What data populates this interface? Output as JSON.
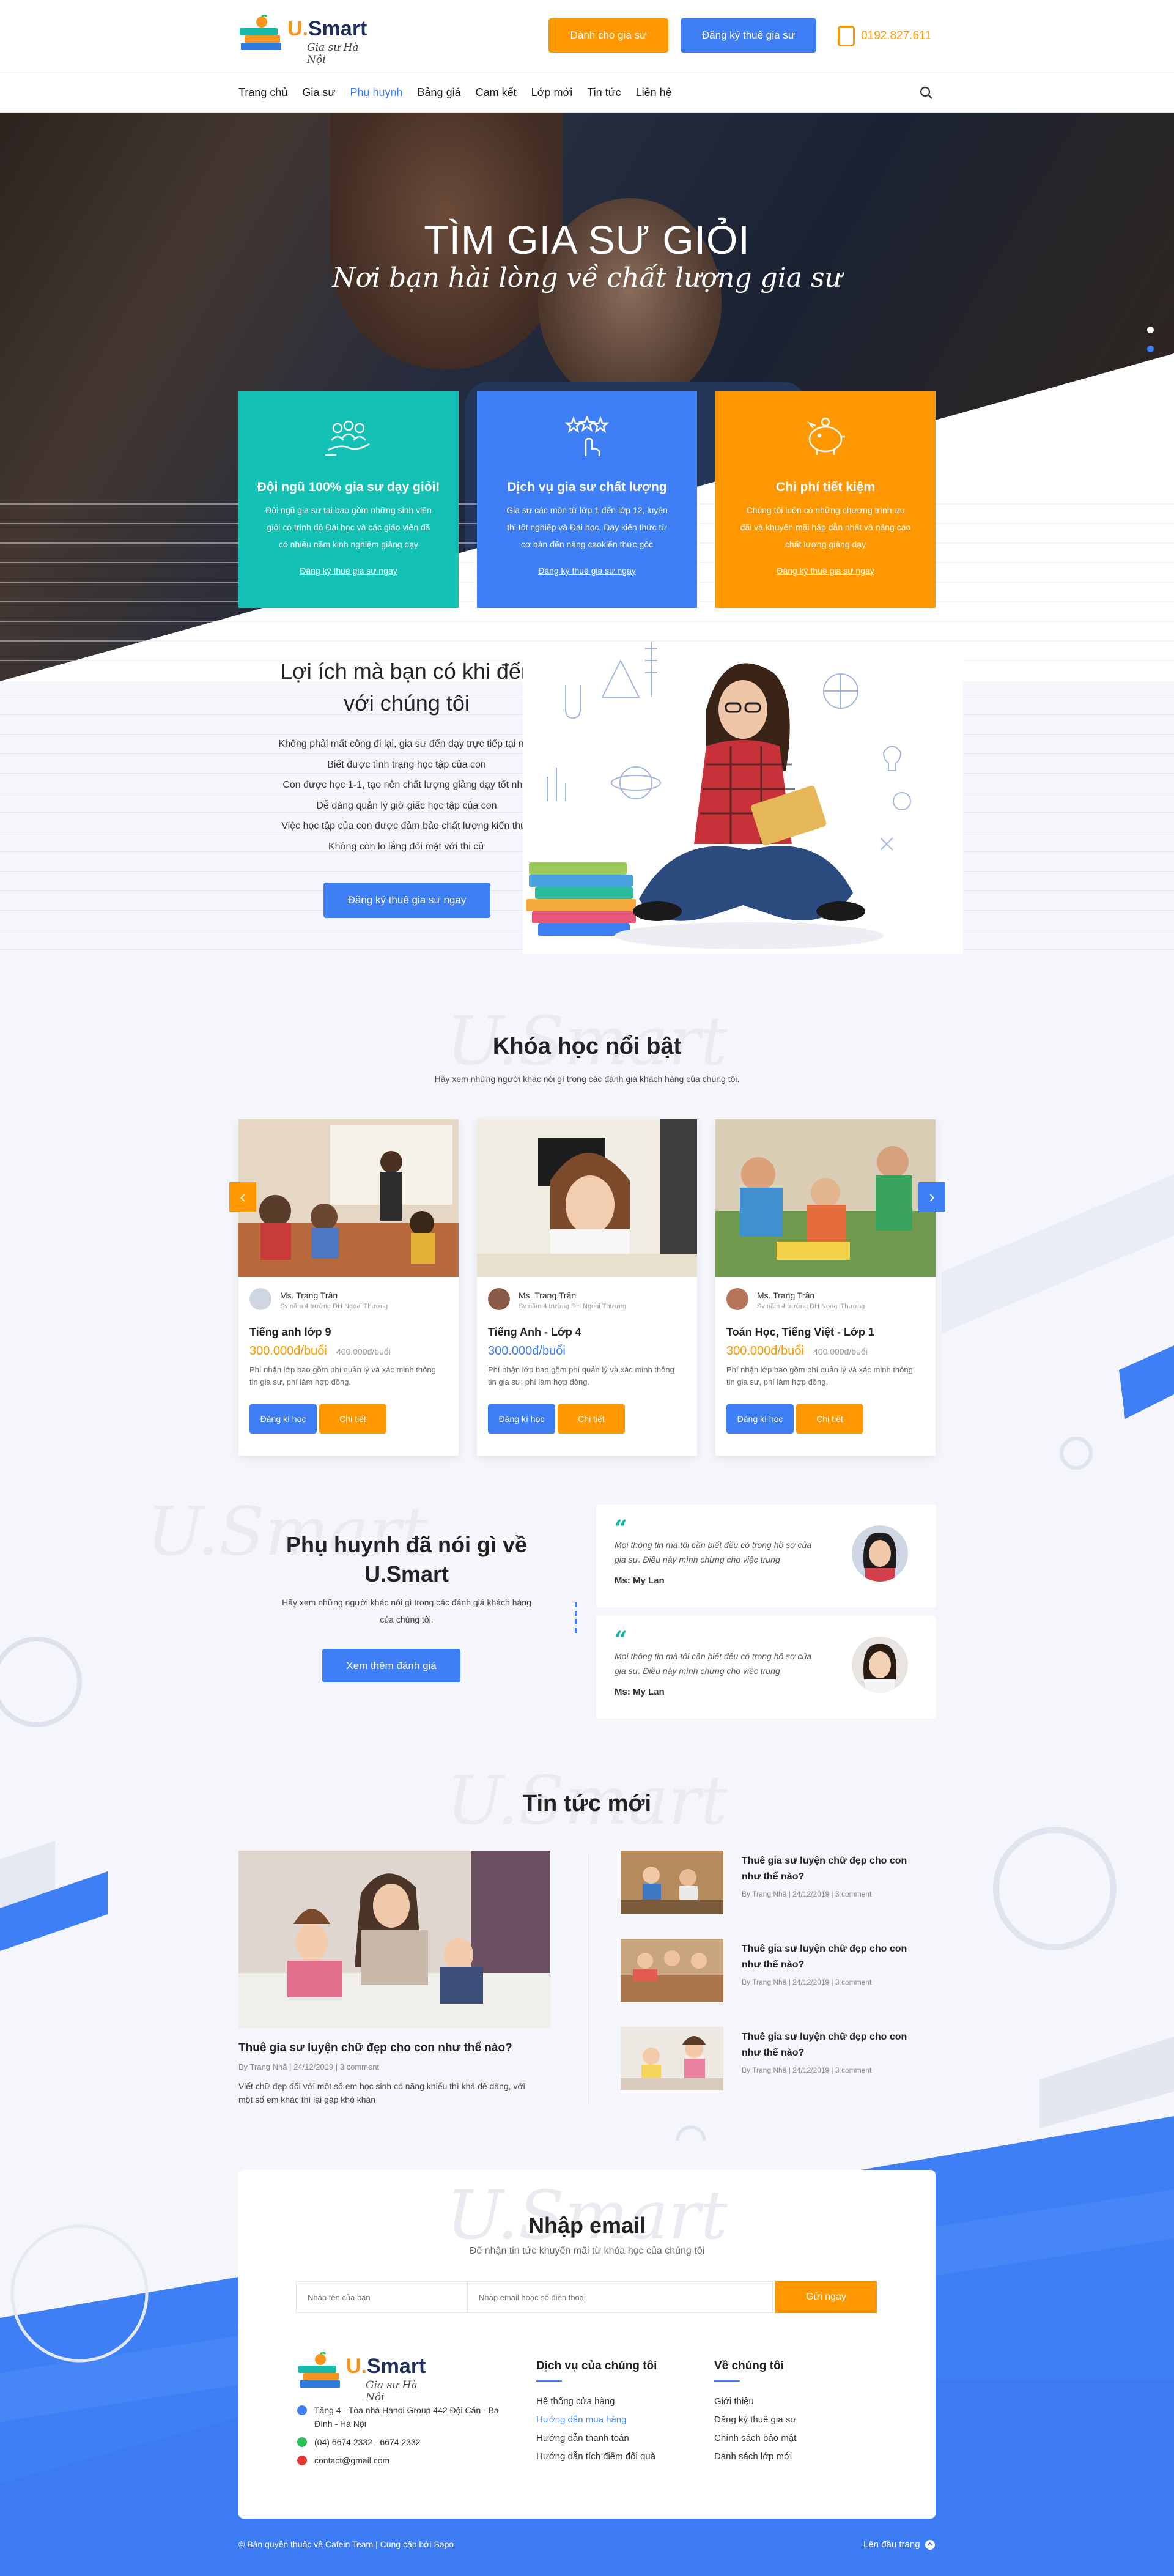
{
  "brand": {
    "logo_main": "Smart",
    "logo_u": "U.",
    "tagline": "Gia sư Hà Nội"
  },
  "header": {
    "btn_tutor": "Dành cho gia sư",
    "btn_hire": "Đăng ký thuê gia sư",
    "phone": "0192.827.611"
  },
  "nav": {
    "items": [
      "Trang chủ",
      "Gia sư",
      "Phụ huynh",
      "Bảng giá",
      "Cam kết",
      "Lớp mới",
      "Tin tức",
      "Liên hệ"
    ],
    "active": "Phụ huynh"
  },
  "hero": {
    "title": "TÌM GIA SƯ GIỎI",
    "subtitle": "Nơi bạn hài lòng về chất lượng gia sư"
  },
  "features": [
    {
      "title": "Đội ngũ 100% gia sư dạy giỏi!",
      "text": "Đội ngũ gia sư tại bao gồm những sinh viên giỏi có trình độ Đại học và các giáo viên đã có nhiều năm kinh nghiệm giảng dạy",
      "link": "Đăng ký thuê gia sư ngay",
      "color": "#12c1b3"
    },
    {
      "title": "Dịch vụ gia sư chất lượng",
      "text": "Gia sư các môn từ lớp 1 đến lớp 12, luyện thi tốt nghiệp và Đại học, Dạy kiến thức từ cơ bản đến nâng caokiến thức gốc",
      "link": "Đăng ký thuê gia sư ngay",
      "color": "#3f7ff5"
    },
    {
      "title": "Chi phí tiết kiệm",
      "text": "Chúng tôi luôn có những chương trình ưu đãi và khuyến mãi hấp dẫn nhất và nâng cao chất lượng giảng dạy",
      "link": "Đăng ký thuê gia sư ngay",
      "color": "#ff9800"
    }
  ],
  "benefits": {
    "title": "Lợi ích mà bạn có khi đến với chúng tôi",
    "items": [
      "Không phải mất công đi lại, gia sư đến dạy trực tiếp tại nhà",
      "Biết được tình trạng học tập của con",
      "Con được học 1-1, tạo nên chất lượng giảng dạy tốt nhất",
      "Dễ dàng quản lý giờ giấc học tập của con",
      "Việc học tập của con được đảm bảo chất lượng kiến thức",
      "Không còn lo lắng đối mặt với thi cử"
    ],
    "button": "Đăng ký thuê gia sư ngay"
  },
  "courses": {
    "watermark": "U.Smart",
    "title": "Khóa học nổi bật",
    "subtitle": "Hãy xem những người khác nói gì trong các đánh giá khách hàng của chúng tôi.",
    "prev": "‹",
    "next": "›",
    "items": [
      {
        "teacher": "Ms. Trang Trần",
        "teacher_desc": "Sv năm 4 trường ĐH Ngoại Thương",
        "name": "Tiếng anh lớp 9",
        "price": "300.000đ/buổi",
        "old_price": "400.000đ/buổi",
        "desc": "Phí nhận lớp bao gồm phí quản lý và xác minh thông tin gia sư, phí làm hợp đồng.",
        "btn_enroll": "Đăng kí học",
        "btn_detail": "Chi tiết",
        "price_color": "#ff9800"
      },
      {
        "teacher": "Ms. Trang Trần",
        "teacher_desc": "Sv năm 4 trường ĐH Ngoại Thương",
        "name": "Tiếng Anh - Lớp 4",
        "price": "300.000đ/buổi",
        "old_price": "",
        "desc": "Phí nhận lớp bao gồm phí quản lý và xác minh thông tin gia sư, phí làm hợp đồng.",
        "btn_enroll": "Đăng kí học",
        "btn_detail": "Chi tiết",
        "price_color": "#3f7ff5"
      },
      {
        "teacher": "Ms. Trang Trần",
        "teacher_desc": "Sv năm 4 trường ĐH Ngoại Thương",
        "name": "Toán Học, Tiếng Việt - Lớp 1",
        "price": "300.000đ/buổi",
        "old_price": "400.000đ/buổi",
        "desc": "Phí nhận lớp bao gồm phí quản lý và xác minh thông tin gia sư, phí làm hợp đồng.",
        "btn_enroll": "Đăng kí học",
        "btn_detail": "Chi tiết",
        "price_color": "#ff9800"
      }
    ]
  },
  "testimonials": {
    "watermark": "U.Smart",
    "title": "Phụ huynh đã nói gì về U.Smart",
    "subtitle": "Hãy xem những người khác nói gì trong các đánh giá khách hàng của chúng tôi.",
    "button": "Xem thêm đánh giá",
    "quote_mark": "“",
    "items": [
      {
        "text": "Mọi thông tin mà tôi cần biết đều có trong hồ sơ của gia sư. Điều này mình chừng cho việc trung",
        "name": "Ms: My Lan"
      },
      {
        "text": "Mọi thông tin mà tôi cần biết đều có trong hồ sơ của gia sư. Điều này mình chừng cho việc trung",
        "name": "Ms: My Lan"
      }
    ]
  },
  "news": {
    "watermark": "U.Smart",
    "title": "Tin tức mới",
    "main": {
      "title": "Thuê gia sư luyện chữ đẹp cho con như thế nào?",
      "meta": "By Trang Nhã  |  24/12/2019  |  3 comment",
      "desc": "Viết chữ đẹp đối với một số em học sinh có năng khiếu thì khá dễ dàng, với một số em khác thì lại gặp khó khăn"
    },
    "items": [
      {
        "title": "Thuê gia sư luyện chữ đẹp cho con như thế nào?",
        "meta": "By Trang Nhã  |  24/12/2019  |  3 comment"
      },
      {
        "title": "Thuê gia sư luyện chữ đẹp cho con như thế nào?",
        "meta": "By Trang Nhã  |  24/12/2019  |  3 comment"
      },
      {
        "title": "Thuê gia sư luyện chữ đẹp cho con như thế nào?",
        "meta": "By Trang Nhã  |  24/12/2019  |  3 comment"
      }
    ]
  },
  "newsletter": {
    "watermark": "U.Smart",
    "title": "Nhập email",
    "subtitle": "Để nhận tin tức khuyến mãi từ khóa học của chúng tôi",
    "name_placeholder": "Nhập tên của bạn",
    "phone_placeholder": "Nhập email hoặc số điện thoại",
    "button": "Gửi ngay"
  },
  "footer": {
    "contact": [
      {
        "text": "Tầng 4 - Tòa nhà Hanoi Group 442 Đội Cấn - Ba Đình - Hà Nội",
        "color": "#3f7ff5"
      },
      {
        "text": "(04) 6674 2332 - 6674 2332",
        "color": "#2bbf5a"
      },
      {
        "text": "contact@gmail.com",
        "color": "#e53935"
      }
    ],
    "col1": {
      "title": "Dịch vụ của chúng tôi",
      "items": [
        "Hệ thống cửa hàng",
        "Hướng dẫn mua hàng",
        "Hướng dẫn thanh toán",
        "Hướng dẫn tích điểm đổi quà"
      ],
      "highlight": 1
    },
    "col2": {
      "title": "Về chúng tôi",
      "items": [
        "Giới thiệu",
        "Đăng ký thuê gia sư",
        "Chính sách bảo mật",
        "Danh sách lớp mới"
      ]
    },
    "copyright": "© Bản quyền thuộc về Cafein Team | Cung cấp bởi Sapo",
    "to_top": "Lên đầu trang"
  },
  "colors": {
    "blue": "#3f7ff5",
    "orange": "#ff9800",
    "teal": "#12c1b3",
    "dark_blue": "#1f2f5a"
  }
}
